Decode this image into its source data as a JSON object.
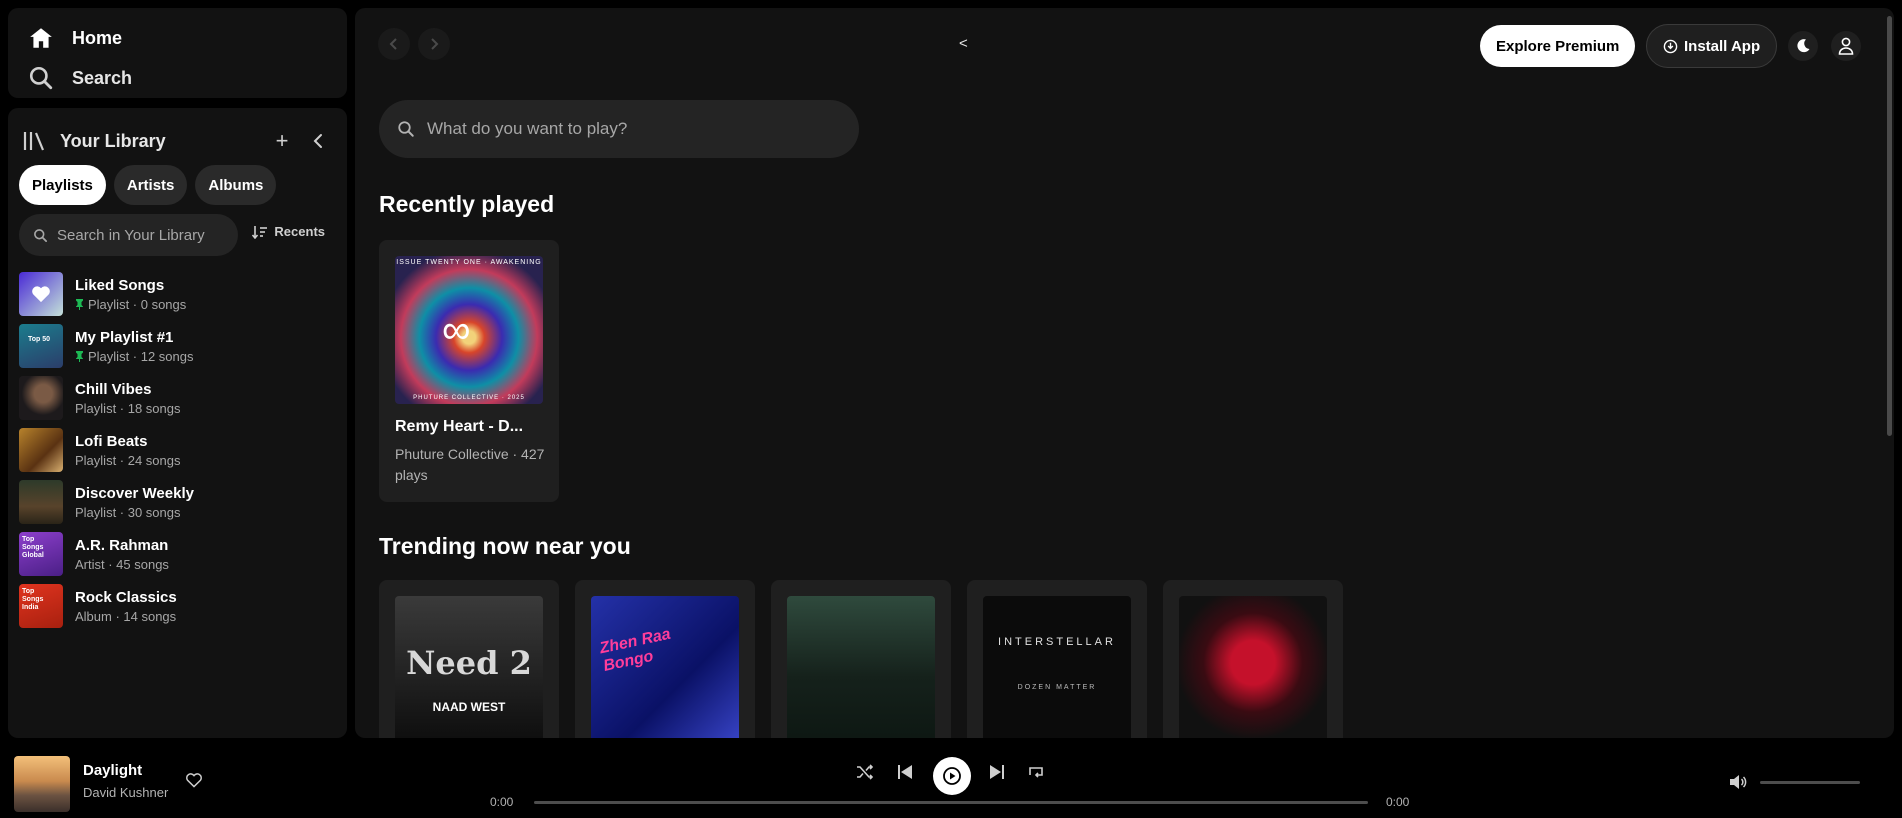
{
  "nav": {
    "home": "Home",
    "search": "Search"
  },
  "library": {
    "title": "Your Library",
    "chips": [
      "Playlists",
      "Artists",
      "Albums"
    ],
    "search_placeholder": "Search in Your Library",
    "sort_label": "Recents",
    "items": [
      {
        "name": "Liked Songs",
        "meta": "Playlist · 0 songs",
        "pinned": true
      },
      {
        "name": "My Playlist #1",
        "meta": "Playlist · 12 songs",
        "pinned": true,
        "thumb_text": "Top 50"
      },
      {
        "name": "Chill Vibes",
        "meta": "Playlist · 18 songs",
        "pinned": false
      },
      {
        "name": "Lofi Beats",
        "meta": "Playlist · 24 songs",
        "pinned": false
      },
      {
        "name": "Discover Weekly",
        "meta": "Playlist · 30 songs",
        "pinned": false
      },
      {
        "name": "A.R. Rahman",
        "meta": "Artist · 45 songs",
        "pinned": false,
        "thumb_text": "Top Songs Global"
      },
      {
        "name": "Rock Classics",
        "meta": "Album · 14 songs",
        "pinned": false,
        "thumb_text": "Top Songs India"
      }
    ]
  },
  "header": {
    "collapse_glyph": "<",
    "explore_premium": "Explore Premium",
    "install_app": "Install App"
  },
  "main": {
    "search_placeholder": "What do you want to play?",
    "recently_played_title": "Recently played",
    "recent_card": {
      "title": "Remy Heart - D...",
      "subtitle": "Phuture Collective · 427 plays",
      "art_top_text": "ISSUE TWENTY ONE · AWAKENING",
      "art_bottom_text": "PHUTURE COLLECTIVE · 2025"
    },
    "trending_title": "Trending now near you",
    "trending_art_text": [
      "Need 2",
      "NAAD WEST",
      "Zhen Raa Bongo",
      "",
      "INTERSTELLAR",
      "DOZEN MATTER",
      ""
    ]
  },
  "player": {
    "title": "Daylight",
    "artist": "David Kushner",
    "elapsed": "0:00",
    "duration": "0:00",
    "progress": 0,
    "volume": 0
  },
  "colors": {
    "accent": "#1db954",
    "surface": "#121212",
    "card": "#1f1f1f"
  }
}
